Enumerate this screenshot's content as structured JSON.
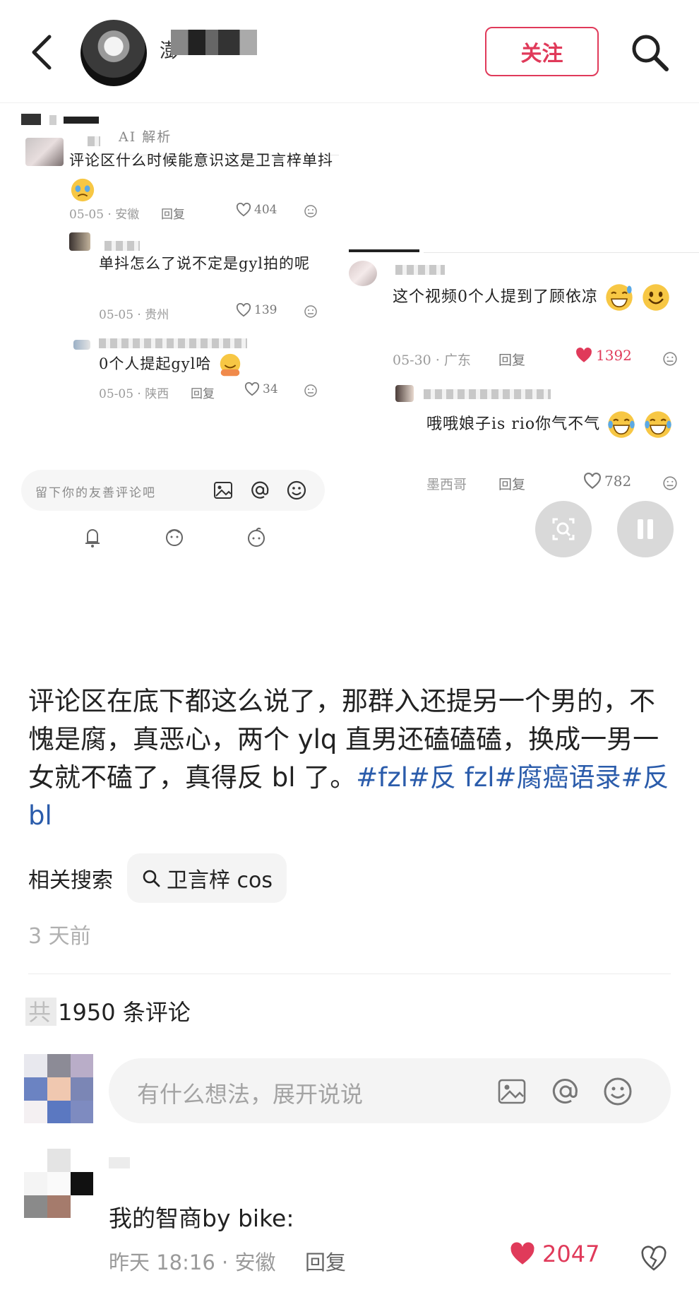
{
  "header": {
    "author_name": "澎",
    "follow_label": "关注"
  },
  "screenshot": {
    "ai_tag": "AI 解析",
    "left_comments": [
      {
        "text": "评论区什么时候能意识这是卫言梓单抖",
        "date": "05-05",
        "region": "安徽",
        "reply": "回复",
        "likes": "404"
      },
      {
        "text": "单抖怎么了说不定是gyl拍的呢",
        "date": "05-05",
        "region": "贵州",
        "reply": "",
        "likes": "139"
      },
      {
        "text": "0个人提起gyl哈",
        "date": "05-05",
        "region": "陕西",
        "reply": "回复",
        "likes": "34"
      }
    ],
    "input_placeholder": "留下你的友善评论吧",
    "right_comments": [
      {
        "text": "这个视频0个人提到了顾依凉",
        "date": "05-30",
        "region": "广东",
        "reply": "回复",
        "likes": "1392"
      },
      {
        "text": "哦哦娘子is rio你气不气",
        "date": "",
        "region": "墨西哥",
        "reply": "回复",
        "likes": "782"
      }
    ]
  },
  "post": {
    "body": "评论区在底下都这么说了，那群入还提另一个男的，不愧是腐，真恶心，两个 ylq 直男还磕磕磕，换成一男一女就不磕了，真得反 bl 了。",
    "tags": "#fzl#反 fzl#腐癌语录#反 bl",
    "related_label": "相关搜索",
    "related_query": "卫言梓 cos",
    "time_ago": "3 天前",
    "comment_count": "共 1950 条评论"
  },
  "comment_box": {
    "placeholder": "有什么想法，展开说说"
  },
  "top_comment": {
    "text": "我的智商by bike:",
    "meta": "昨天 18:16 · 安徽",
    "reply": "回复",
    "likes": "2047"
  },
  "colors": {
    "accent": "#e03a5a",
    "hashtag": "#2b5cab"
  }
}
